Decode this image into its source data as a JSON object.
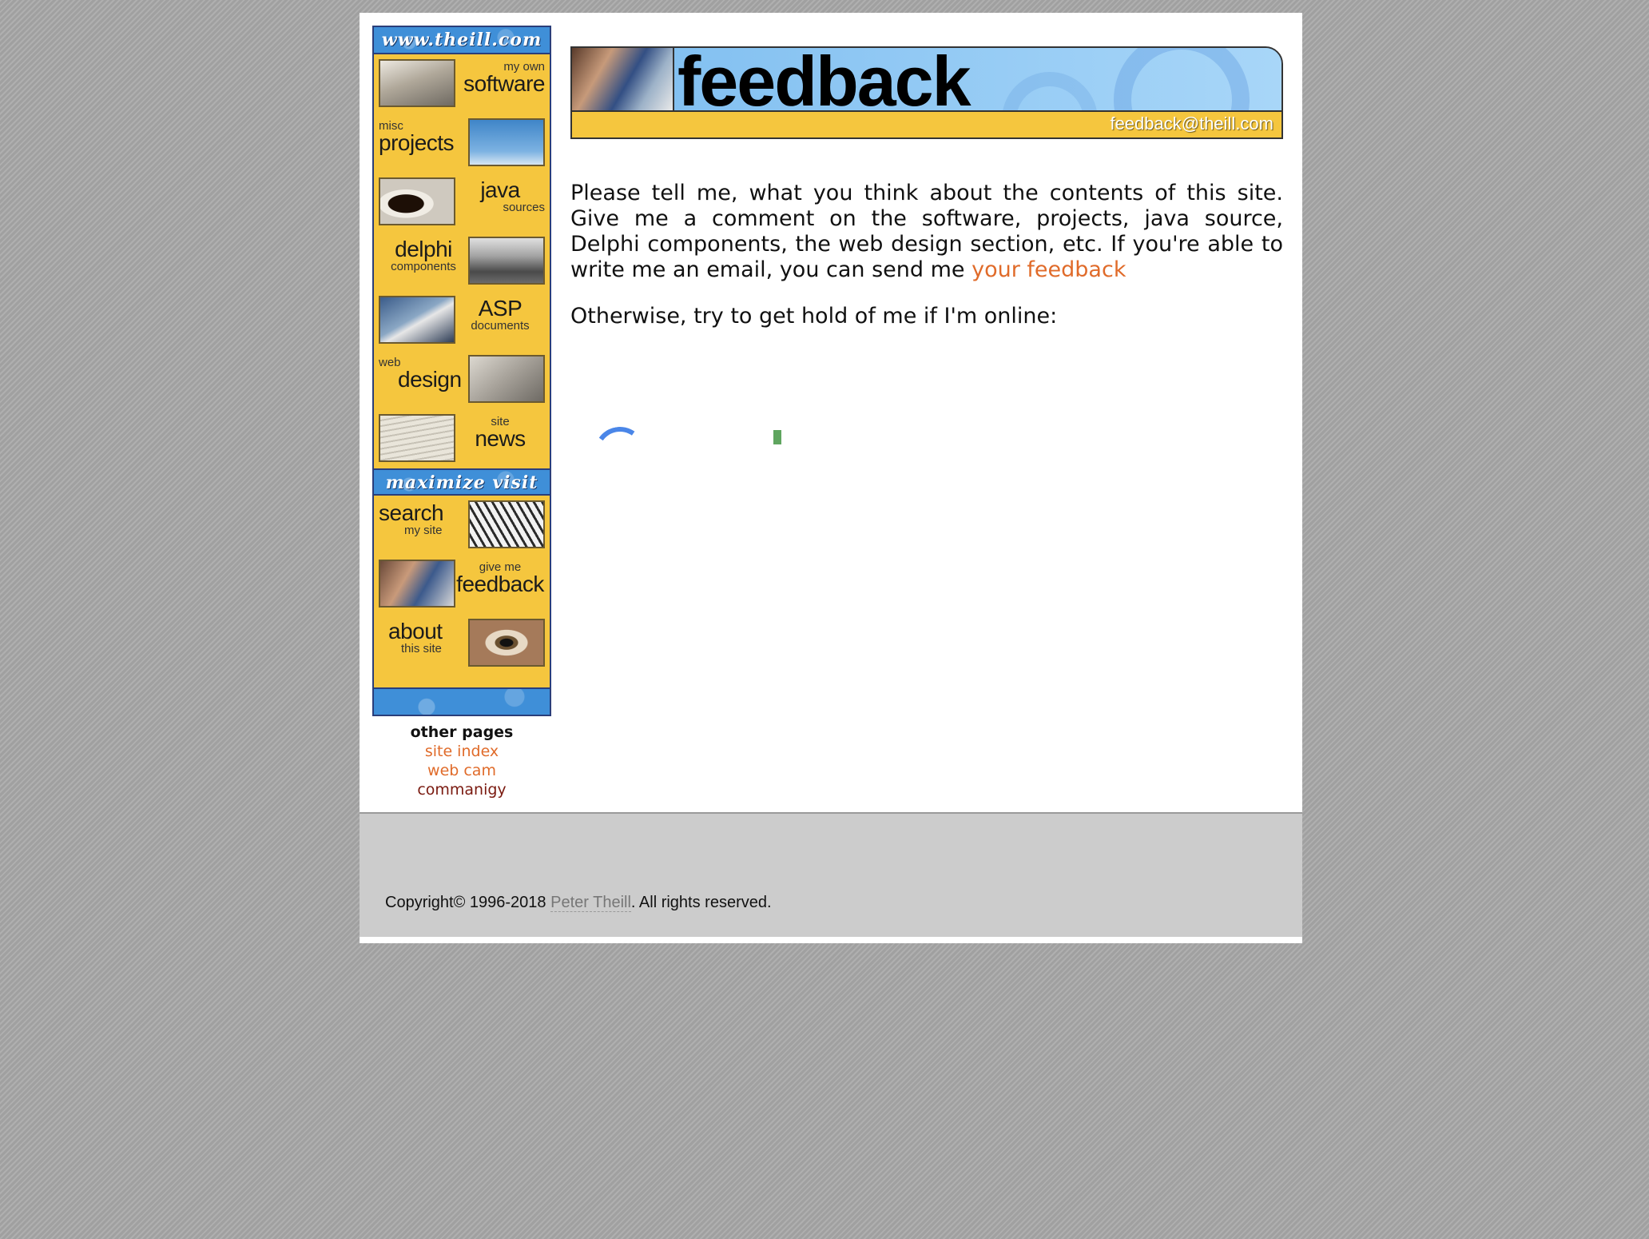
{
  "nav": {
    "header_top": "www.theill.com",
    "header_mid": "maximize visit",
    "items": [
      {
        "small": "my own",
        "big": "software",
        "thumb_side": "left"
      },
      {
        "small": "misc",
        "big": "projects",
        "thumb_side": "right"
      },
      {
        "small": "sources",
        "big": "java",
        "thumb_side": "left"
      },
      {
        "small": "components",
        "big": "delphi",
        "thumb_side": "right"
      },
      {
        "small": "documents",
        "big": "ASP",
        "thumb_side": "left"
      },
      {
        "small": "web",
        "big": "design",
        "thumb_side": "right"
      },
      {
        "small": "site",
        "big": "news",
        "thumb_side": "left"
      }
    ],
    "items2": [
      {
        "small": "my site",
        "big": "search",
        "thumb_side": "right"
      },
      {
        "small": "give me",
        "big": "feedback",
        "thumb_side": "left"
      },
      {
        "small": "this site",
        "big": "about",
        "thumb_side": "right"
      }
    ]
  },
  "other_pages": {
    "heading": "other pages",
    "links": [
      "site index",
      "web cam",
      "commanigy"
    ]
  },
  "banner": {
    "title": "feedback",
    "email": "feedback@theill.com"
  },
  "content": {
    "para1": "Please tell me, what you think about the contents of this site. Give me a comment on the software, projects, java source, Delphi components, the web design section, etc. If you're able to write me an email, you can send me",
    "para1_link": "your feedback",
    "para2": "Otherwise, try to get hold of me if I'm online:"
  },
  "footer": {
    "copyright_prefix": "Copyright© 1996-2018",
    "author": "Peter Theill",
    "copyright_suffix": ". All rights reserved."
  },
  "colors": {
    "nav_yellow": "#f5c63e",
    "nav_blue": "#3f8fd8",
    "link_orange": "#e06b2a",
    "spinner_blue": "#4a86e8"
  },
  "icons": [
    "software-icon",
    "turbines-icon",
    "coffee-icon",
    "stones-icon",
    "bird-icon",
    "statue-icon",
    "newspaper-icon",
    "bridge-icon",
    "phone-icon",
    "eye-icon"
  ]
}
